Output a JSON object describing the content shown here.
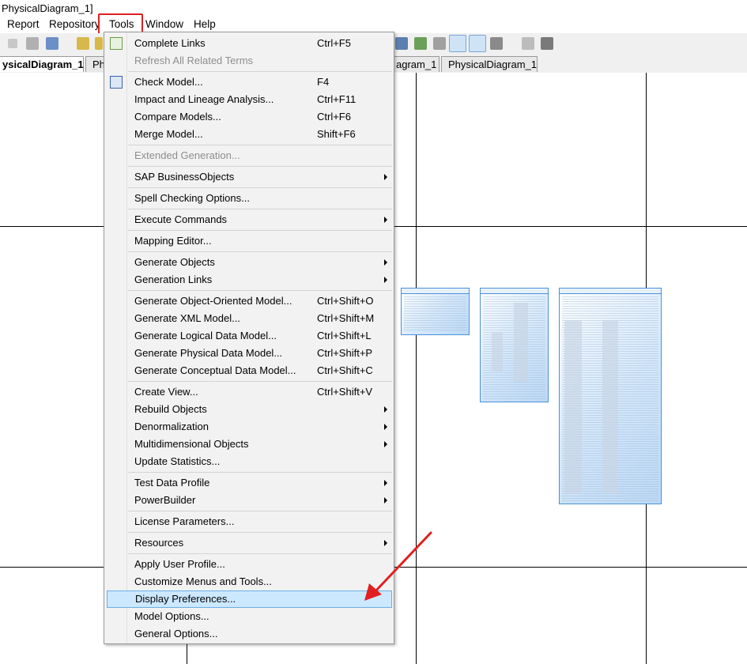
{
  "window": {
    "title": "PhysicalDiagram_1]"
  },
  "menubar": {
    "items": [
      "Report",
      "Repository",
      "Tools",
      "Window",
      "Help"
    ]
  },
  "tabs": [
    "ysicalDiagram_1",
    "Ph",
    "agram_1",
    "PhysicalDiagram_1"
  ],
  "menu": {
    "complete_links": {
      "label": "Complete Links",
      "shortcut": "Ctrl+F5"
    },
    "refresh_terms": {
      "label": "Refresh All Related Terms"
    },
    "check_model": {
      "label": "Check Model...",
      "shortcut": "F4"
    },
    "impact_lineage": {
      "label": "Impact and Lineage Analysis...",
      "shortcut": "Ctrl+F11"
    },
    "compare_models": {
      "label": "Compare Models...",
      "shortcut": "Ctrl+F6"
    },
    "merge_model": {
      "label": "Merge Model...",
      "shortcut": "Shift+F6"
    },
    "extended_generation": {
      "label": "Extended Generation..."
    },
    "sap_bo": {
      "label": "SAP BusinessObjects"
    },
    "spell_check": {
      "label": "Spell Checking Options..."
    },
    "execute_commands": {
      "label": "Execute Commands"
    },
    "mapping_editor": {
      "label": "Mapping Editor..."
    },
    "generate_objects": {
      "label": "Generate Objects"
    },
    "generation_links": {
      "label": "Generation Links"
    },
    "gen_oom": {
      "label": "Generate Object-Oriented Model...",
      "shortcut": "Ctrl+Shift+O"
    },
    "gen_xml": {
      "label": "Generate XML Model...",
      "shortcut": "Ctrl+Shift+M"
    },
    "gen_ldm": {
      "label": "Generate Logical Data Model...",
      "shortcut": "Ctrl+Shift+L"
    },
    "gen_pdm": {
      "label": "Generate Physical Data Model...",
      "shortcut": "Ctrl+Shift+P"
    },
    "gen_cdm": {
      "label": "Generate Conceptual Data Model...",
      "shortcut": "Ctrl+Shift+C"
    },
    "create_view": {
      "label": "Create View...",
      "shortcut": "Ctrl+Shift+V"
    },
    "rebuild_objects": {
      "label": "Rebuild Objects"
    },
    "denormalization": {
      "label": "Denormalization"
    },
    "multidim": {
      "label": "Multidimensional Objects"
    },
    "update_stats": {
      "label": "Update Statistics..."
    },
    "test_data": {
      "label": "Test Data Profile"
    },
    "powerbuilder": {
      "label": "PowerBuilder"
    },
    "license": {
      "label": "License Parameters..."
    },
    "resources": {
      "label": "Resources"
    },
    "apply_profile": {
      "label": "Apply User Profile..."
    },
    "customize": {
      "label": "Customize Menus and Tools..."
    },
    "display_prefs": {
      "label": "Display Preferences..."
    },
    "model_options": {
      "label": "Model Options..."
    },
    "general_options": {
      "label": "General Options..."
    }
  },
  "colors": {
    "highlight_box": "#e02020",
    "menu_hover": "#cce8ff",
    "annotation_arrow": "#e02020",
    "entity_border": "#4a90d9"
  }
}
